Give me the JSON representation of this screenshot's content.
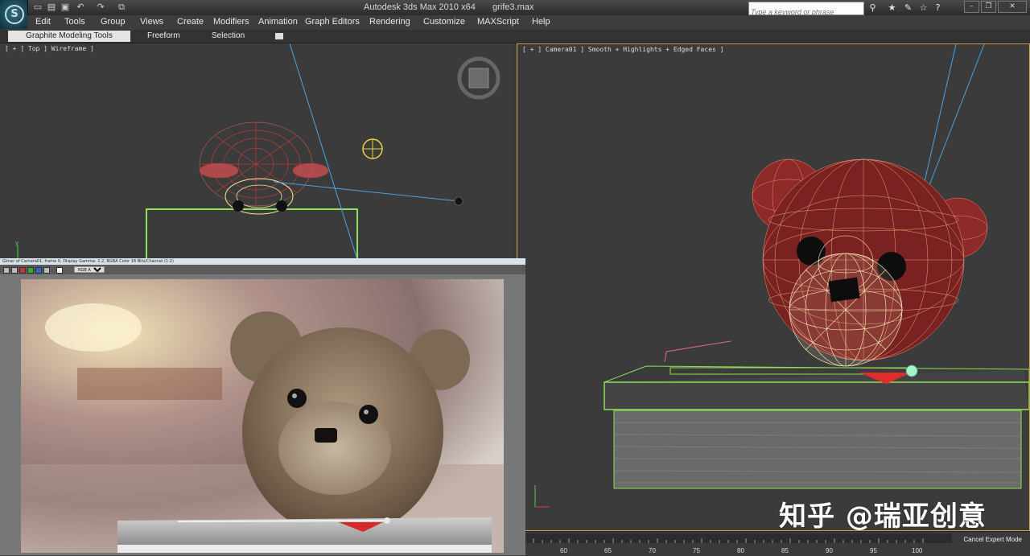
{
  "window": {
    "title": "Autodesk 3ds Max  2010 x64",
    "file": "grife3.max",
    "search_placeholder": "Type a keyword or phrase"
  },
  "quick_access": [
    "new-icon",
    "open-icon",
    "save-icon",
    "undo-icon",
    "redo-icon",
    "project-folder-icon"
  ],
  "title_icons": [
    "binoculars-icon",
    "star-icon",
    "wrench-icon",
    "star-outline-icon",
    "help-icon"
  ],
  "menu": [
    "Edit",
    "Tools",
    "Group",
    "Views",
    "Create",
    "Modifiers",
    "Animation",
    "Graph Editors",
    "Rendering",
    "Customize",
    "MAXScript",
    "Help"
  ],
  "ribbon": {
    "tabs": [
      "Graphite Modeling Tools",
      "Freeform",
      "Selection"
    ],
    "active": "Graphite Modeling Tools"
  },
  "viewports": {
    "top_label": "[ + ] Top ] Wireframe ]",
    "camera_label": "[ + ] Camera01 ] Smooth + Highlights + Edged Faces ]"
  },
  "frame_window": {
    "title": "Gimer of Camera01, frame 0, Display Gamma: 2.2, RGBA Color 16 Bits/Channel (1:2)",
    "channel": "RGB Alpha"
  },
  "timeline": {
    "ticks": [
      "60",
      "65",
      "70",
      "75",
      "80",
      "85",
      "90",
      "95",
      "100"
    ],
    "cancel": "Cancel Expert Mode"
  },
  "watermark": "知乎 @瑞亚创意",
  "colors": {
    "wire_red": "#c23a3a",
    "wire_yellow": "#f3e8a0",
    "select_green": "#8fe05a",
    "camera_line": "#4aa3e0",
    "viewport_bg": "#3b3b3b",
    "active_border": "#caa84a"
  }
}
